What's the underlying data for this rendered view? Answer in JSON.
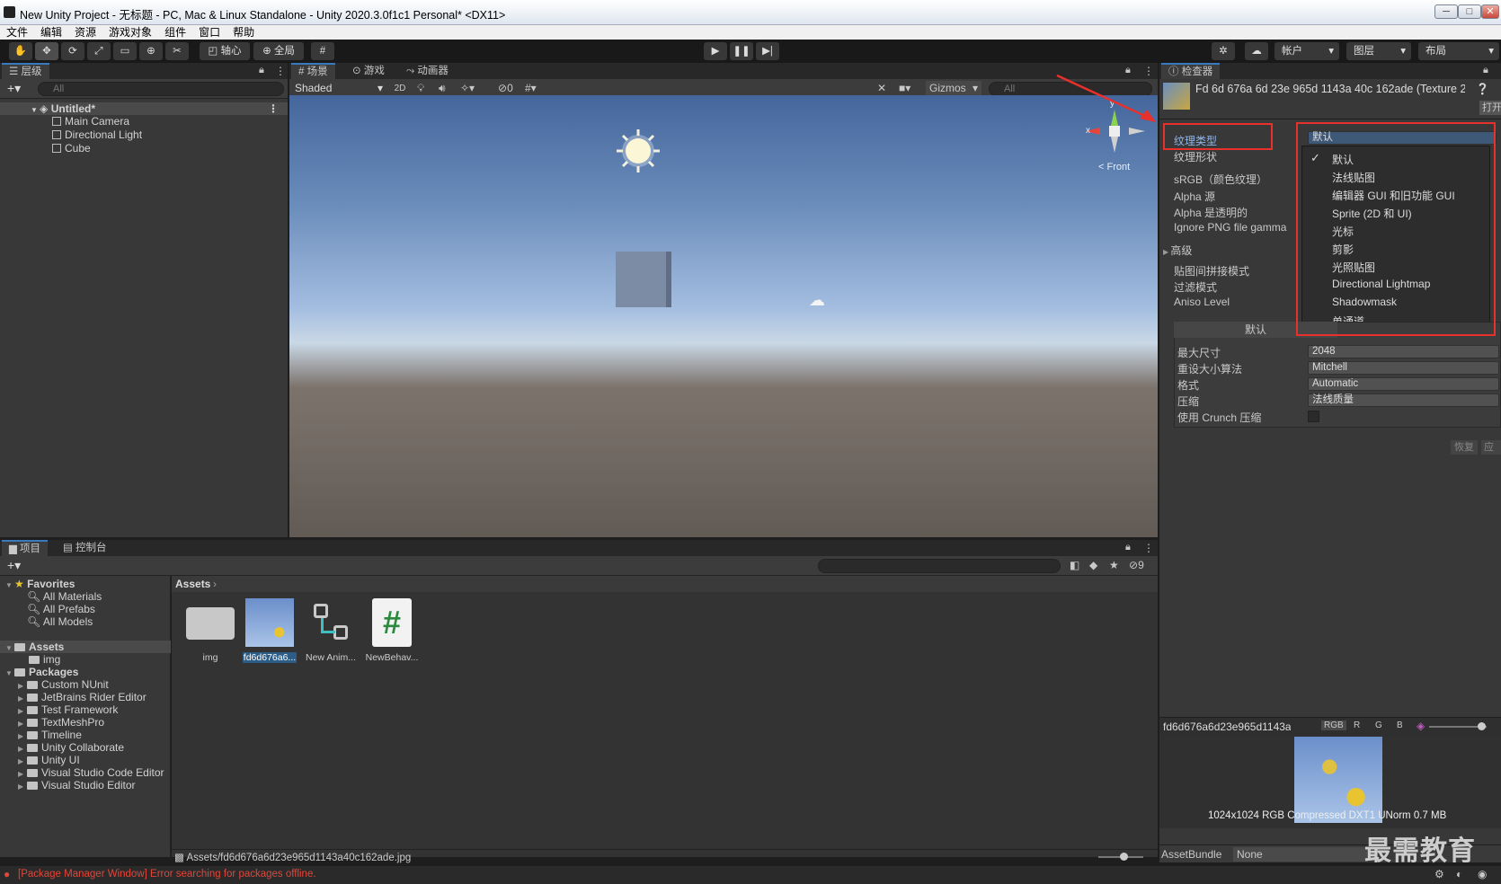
{
  "window": {
    "title": "New Unity Project - 无标题 - PC, Mac & Linux Standalone - Unity 2020.3.0f1c1 Personal* <DX11>",
    "min": "─",
    "max": "□",
    "close": "✕"
  },
  "menu": [
    "文件",
    "编辑",
    "资源",
    "游戏对象",
    "组件",
    "窗口",
    "帮助"
  ],
  "toolbar": {
    "pivot": "轴心",
    "global": "全局",
    "account": "帐户",
    "layers": "图层",
    "layout": "布局"
  },
  "hierarchy": {
    "tab": "层级",
    "search_placeholder": "All",
    "scene_name": "Untitled*",
    "items": [
      "Main Camera",
      "Directional Light",
      "Cube"
    ]
  },
  "scene_tabs": {
    "scene": "场景",
    "game": "游戏",
    "animator": "动画器"
  },
  "scene_toolbar": {
    "shading": "Shaded",
    "mode_2d": "2D",
    "hidden_count": "0",
    "gizmos": "Gizmos",
    "search_placeholder": "All",
    "gizmo_x": "x",
    "gizmo_y": "y",
    "gizmo_label": "< Front"
  },
  "inspector": {
    "tab": "检查器",
    "asset_title": "Fd 6d 676a 6d 23e 965d 1143a 40c 162ade (Texture 2",
    "open_button": "打开",
    "labels": {
      "texture_type": "纹理类型",
      "texture_shape": "纹理形状",
      "srgb": "sRGB（颜色纹理）",
      "alpha_source": "Alpha 源",
      "alpha_transparent": "Alpha 是透明的",
      "ignore_png": "Ignore PNG file gamma",
      "advanced": "高级",
      "wrap_mode": "贴图间拼接模式",
      "filter_mode": "过滤模式",
      "aniso": "Aniso Level"
    },
    "texture_type_value": "默认",
    "dropdown_options": [
      "默认",
      "法线贴图",
      "编辑器 GUI 和旧功能 GUI",
      "Sprite (2D 和 UI)",
      "光标",
      "剪影",
      "光照贴图",
      "Directional Lightmap",
      "Shadowmask",
      "单通道"
    ],
    "dropdown_selected_index": 0,
    "platform_tab": "默认",
    "platform": [
      {
        "label": "最大尺寸",
        "value": "2048"
      },
      {
        "label": "重设大小算法",
        "value": "Mitchell"
      },
      {
        "label": "格式",
        "value": "Automatic"
      },
      {
        "label": "压缩",
        "value": "法线质量"
      }
    ],
    "crunch_label": "使用 Crunch 压缩",
    "revert": "恢复",
    "apply": "应用",
    "preview": {
      "name": "fd6d676a6d23e965d1143a4(",
      "channels": [
        "RGB",
        "R",
        "G",
        "B"
      ],
      "info": "1024x1024  RGB Compressed DXT1 UNorm   0.7 MB"
    },
    "assetbundle_label": "AssetBundle",
    "assetbundle_value": "None"
  },
  "project": {
    "tab_project": "项目",
    "tab_console": "控制台",
    "hidden_count": "9",
    "favorites_label": "Favorites",
    "favorites": [
      "All Materials",
      "All Prefabs",
      "All Models"
    ],
    "assets_label": "Assets",
    "asset_folders": [
      "img"
    ],
    "packages_label": "Packages",
    "packages": [
      "Custom NUnit",
      "JetBrains Rider Editor",
      "Test Framework",
      "TextMeshPro",
      "Timeline",
      "Unity Collaborate",
      "Unity UI",
      "Visual Studio Code Editor",
      "Visual Studio Editor"
    ],
    "breadcrumb": "Assets",
    "assets": [
      {
        "name": "img",
        "kind": "folder-icon"
      },
      {
        "name": "fd6d676a6...",
        "kind": "image-thumbnail"
      },
      {
        "name": "New Anim...",
        "kind": "animator-icon"
      },
      {
        "name": "NewBehav...",
        "kind": "script-icon"
      }
    ],
    "selected_path": "Assets/fd6d676a6d23e965d1143a40c162ade.jpg"
  },
  "status": {
    "message": "[Package Manager Window] Error searching for packages offline."
  },
  "watermark": "最需教育",
  "colors": {
    "accent": "#3a79bb",
    "highlight": "#e8302c",
    "error": "#e0463a"
  }
}
